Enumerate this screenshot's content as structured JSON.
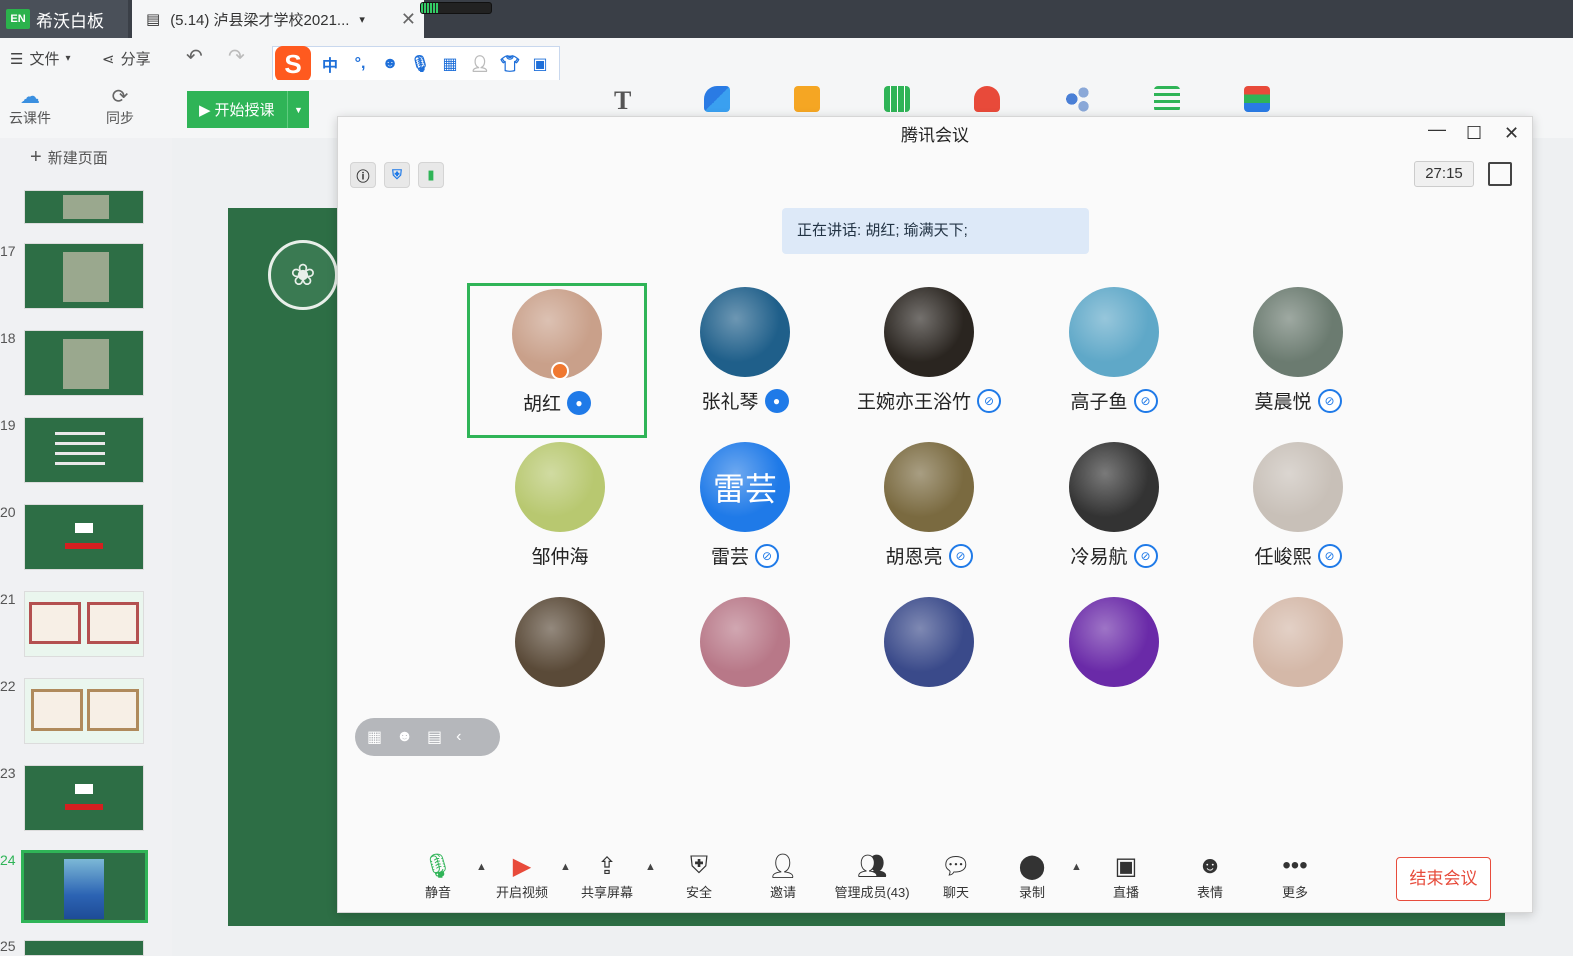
{
  "titlebar": {
    "app_logo": "EN",
    "app_name": "希沃白板",
    "doc_tab": "(5.14) 泸县梁才学校2021...",
    "doc_tab_caret": "▾",
    "close": "✕"
  },
  "menu": {
    "file": "文件",
    "share": "分享",
    "undo": "↶",
    "redo": "↷"
  },
  "ime": {
    "logo": "S",
    "lang": "中",
    "punct": "°,"
  },
  "toolbar": {
    "cloud": "云课件",
    "sync": "同步",
    "start": "开始授课",
    "text_tool": "T"
  },
  "slides": {
    "new_page": "新建页面",
    "numbers": [
      "17",
      "18",
      "19",
      "20",
      "21",
      "22",
      "23",
      "24",
      "25"
    ],
    "selected": "24"
  },
  "meeting": {
    "title": "腾讯会议",
    "timer": "27:15",
    "speaking": "正在讲话: 胡红; 瑜满天下;",
    "participants": [
      {
        "name": "胡红",
        "mic": "active",
        "host": true,
        "color": "#c9a08a"
      },
      {
        "name": "张礼琴",
        "mic": "active",
        "color": "#1f5f8a"
      },
      {
        "name": "王婉亦王浴竹",
        "mic": "muted",
        "color": "#2a2520"
      },
      {
        "name": "高子鱼",
        "mic": "muted",
        "color": "#5fa8c8"
      },
      {
        "name": "莫晨悦",
        "mic": "muted",
        "color": "#6b7b70"
      },
      {
        "name": "邹仲海",
        "mic": "none",
        "color": "#b8c870"
      },
      {
        "name": "雷芸",
        "mic": "muted",
        "color": "#1f7ae8",
        "initials": "雷芸"
      },
      {
        "name": "胡恩亮",
        "mic": "muted",
        "color": "#7a6a40"
      },
      {
        "name": "冷易航",
        "mic": "muted",
        "color": "#333333"
      },
      {
        "name": "任峻熙",
        "mic": "muted",
        "color": "#c8c0b8"
      },
      {
        "name": "",
        "mic": "none",
        "color": "#5a4a38"
      },
      {
        "name": "",
        "mic": "none",
        "color": "#b87888"
      },
      {
        "name": "",
        "mic": "none",
        "color": "#3a4a8a"
      },
      {
        "name": "",
        "mic": "none",
        "color": "#6a2aa8"
      },
      {
        "name": "",
        "mic": "none",
        "color": "#d4b8a8"
      }
    ],
    "bottom": {
      "mute": "静音",
      "video": "开启视频",
      "share_screen": "共享屏幕",
      "security": "安全",
      "invite": "邀请",
      "members": "管理成员(43)",
      "chat": "聊天",
      "record": "录制",
      "live": "直播",
      "emoji": "表情",
      "more": "更多",
      "end": "结束会议"
    }
  },
  "colors": {
    "green": "#2fb457",
    "blue": "#1f7ae8",
    "slide": "#2d6e45",
    "end": "#e74c3c"
  }
}
